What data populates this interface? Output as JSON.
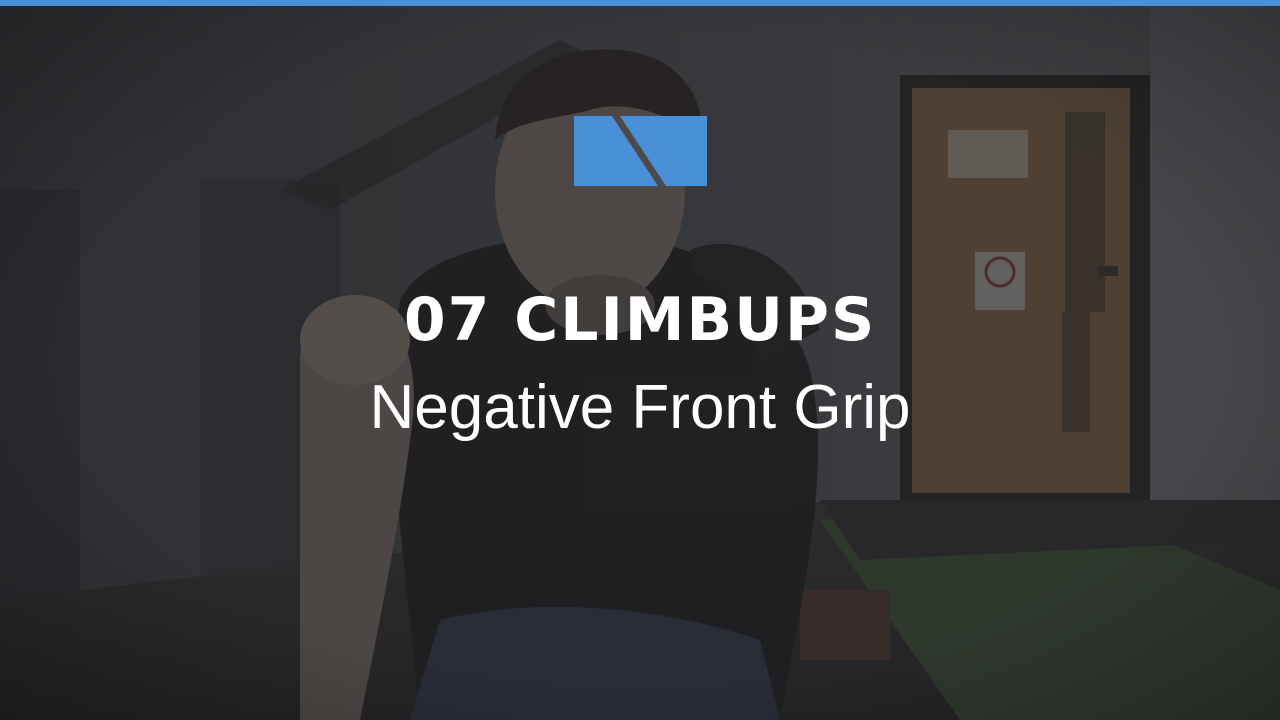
{
  "video": {
    "title": "07 CLIMBUPS",
    "subtitle": "Negative Front Grip"
  },
  "colors": {
    "accent": "#4a90d9",
    "text": "#ffffff"
  },
  "logo": {
    "icon": "brand-logo-icon"
  }
}
